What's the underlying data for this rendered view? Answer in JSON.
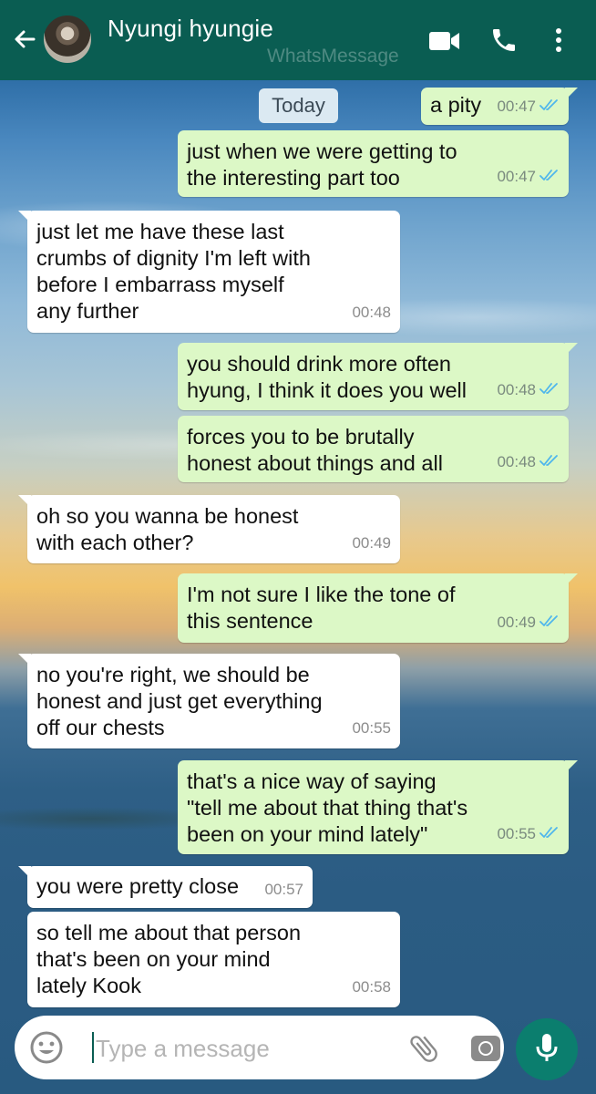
{
  "header": {
    "contact_name": "Nyungi hyungie",
    "watermark": "WhatsMessage",
    "icons": [
      "back-arrow-icon",
      "avatar",
      "video-call-icon",
      "phone-icon",
      "more-vertical-icon"
    ]
  },
  "chat": {
    "date_label": "Today",
    "messages": [
      {
        "dir": "out",
        "text": "a pity",
        "time": "00:47",
        "ticks": "read"
      },
      {
        "dir": "out",
        "text": "just when we were getting to\nthe interesting part too",
        "time": "00:47",
        "ticks": "read"
      },
      {
        "dir": "in",
        "text": "just let me have these last\ncrumbs of dignity I'm left with\nbefore I embarrass myself\nany further",
        "time": "00:48"
      },
      {
        "dir": "out",
        "text": "you should drink more often\nhyung, I think it does you well",
        "time": "00:48",
        "ticks": "read"
      },
      {
        "dir": "out",
        "text": "forces you to be brutally\nhonest about things and all",
        "time": "00:48",
        "ticks": "read"
      },
      {
        "dir": "in",
        "text": "oh so you wanna be honest\nwith each other?",
        "time": "00:49"
      },
      {
        "dir": "out",
        "text": "I'm not sure I like the tone of\nthis sentence",
        "time": "00:49",
        "ticks": "read"
      },
      {
        "dir": "in",
        "text": "no you're right, we should be\nhonest and just get everything\noff our chests",
        "time": "00:55"
      },
      {
        "dir": "out",
        "text": "that's a nice way of saying\n\"tell me about that thing that's\nbeen on your mind lately\"",
        "time": "00:55",
        "ticks": "read"
      },
      {
        "dir": "in",
        "text": "you were pretty close",
        "time": "00:57"
      },
      {
        "dir": "in",
        "text": "so tell me about that person\nthat's been on your mind\nlately Kook",
        "time": "00:58"
      }
    ]
  },
  "composer": {
    "placeholder": "Type a message",
    "icons": [
      "emoji-icon",
      "attach-icon",
      "camera-icon",
      "mic-icon"
    ]
  },
  "colors": {
    "header": "#0a5d52",
    "outgoing_bubble": "#dcf8c6",
    "incoming_bubble": "#ffffff",
    "read_tick": "#4fb6ec",
    "mic_button": "#0b7e6e"
  }
}
